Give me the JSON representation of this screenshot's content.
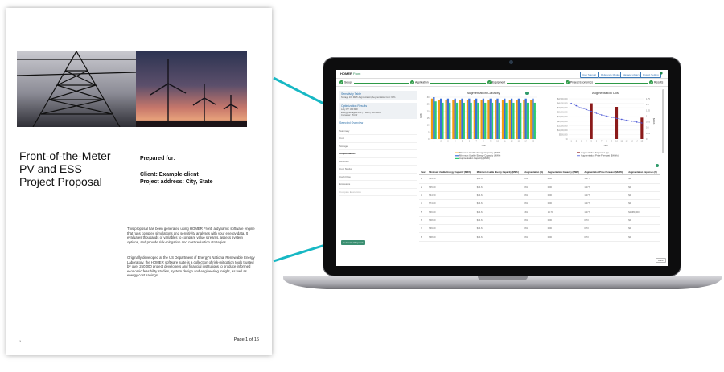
{
  "proposal": {
    "title_lines": [
      "Front-of-the-Meter",
      "PV and ESS",
      "Project Proposal"
    ],
    "prepared_for": "Prepared for:",
    "client": "Client: Example client",
    "project_address": "Project address: City, State",
    "paragraph1": "This proposal has been generated using HOMER Front, a dynamic software engine that runs complex simulations and sensitivity analyses with your energy data. It evaluates thousands of variables to compare value streams, assess system options, and provide risk-mitigation and cost-reduction strategies.",
    "paragraph2": "Originally developed at the US Department of Energy's National Renewable Energy Laboratory, the HOMER software suite is a collection of risk-mitigation tools trusted by over 250,000 project developers and financial institutions to produce informed economic feasibility studies, system design and engineering insight, as well as energy cost savings.",
    "page_label": "Page 1 of 16",
    "corner_mark": "1"
  },
  "app": {
    "logo": "HOMER",
    "logo_suffix": "Front",
    "top_buttons": [
      "User Manual",
      "Reference Modes",
      "Manage Library",
      "Project Setting"
    ],
    "steps": [
      "Setup",
      "Application",
      "Equipment",
      "Project Economics",
      "Results"
    ],
    "sidebar": {
      "sensitivity_title": "Sensitivity Table",
      "sensitivity_text": "Storage 100 MWh Augmentation; Augmentation Cost: 90%",
      "optimization_title": "Optimization Results",
      "optimization_lines": [
        "Lazy PV: 300 MW",
        "Energy Storage 1-100 ( 3 MWh): 100 MWh",
        "Converter: 95 kW"
      ],
      "selected_title": "Selected Overview",
      "items": [
        "Summary",
        "Cost",
        "Storage",
        "Augmentation",
        "Revenue",
        "Cost Stacks",
        "Cash Flow",
        "Emissions",
        "Compare Economics"
      ],
      "active_index": 3,
      "create_button": "Create Proposal"
    },
    "results_table": {
      "headers": [
        "Year",
        "Minimum Usable Energy Capacity (MWh)",
        "Minimum Usable Energy Capacity (MWh)",
        "Augmentation (%)",
        "Augmentation Capacity (MWh)",
        "Augmentation Price Forecast ($/kWh)",
        "Augmentation Expenses ($)"
      ],
      "rows": [
        [
          "1",
          "$44.90",
          "$44.61",
          "0%",
          "0.00",
          "1.27 $",
          "$0"
        ],
        [
          "2",
          "$45.60",
          "$44.61",
          "0%",
          "0.00",
          "1.27 $",
          "$0"
        ],
        [
          "3",
          "$44.90",
          "$44.61",
          "0%",
          "0.00",
          "1.27 $",
          "$0"
        ],
        [
          "4",
          "$74.00",
          "$44.61",
          "0%",
          "0.00",
          "1.27 $",
          "$0"
        ],
        [
          "5",
          "$46.00",
          "$44.61",
          "4%",
          "14.70",
          "1.27 $",
          "$1,380,000"
        ],
        [
          "6",
          "$48.00",
          "$44.61",
          "0%",
          "0.00",
          "0.73",
          "$0"
        ],
        [
          "7",
          "$39.00",
          "$44.61",
          "0%",
          "0.00",
          "0.73",
          "$0"
        ],
        [
          "8",
          "$38.00",
          "$44.61",
          "0%",
          "0.00",
          "0.73",
          "$0"
        ]
      ],
      "back_label": "Back"
    }
  },
  "chart_data": [
    {
      "type": "bar",
      "title": "Augmentation Capacity",
      "ylabel": "MWh",
      "xlabel": "Year",
      "categories": [
        "1",
        "2",
        "3",
        "4",
        "5",
        "6",
        "7",
        "8",
        "9",
        "10",
        "11",
        "12",
        "13",
        "14",
        "15"
      ],
      "series": [
        {
          "name": "Minimum Usable Energy Capacity (MWh)",
          "color": "#f39c12",
          "values": [
            29,
            28,
            28,
            28,
            28,
            28,
            28,
            28,
            28,
            28,
            28,
            28,
            28,
            28,
            28
          ]
        },
        {
          "name": "Minimum Usable Energy Capacity (MWh)",
          "color": "#3b6fd8",
          "values": [
            30,
            29,
            29,
            29,
            29,
            29,
            29,
            29,
            29,
            29,
            29,
            29,
            29,
            29,
            29
          ]
        },
        {
          "name": "Augmentation Capacity (MWh)",
          "color": "#2ecc71",
          "values": [
            27,
            26,
            26,
            26,
            26,
            26,
            26,
            26,
            26,
            26,
            26,
            26,
            26,
            26,
            26
          ]
        }
      ],
      "ylim": [
        0,
        30
      ],
      "y_ticks": [
        "0",
        "5",
        "10",
        "15",
        "20",
        "25",
        "30"
      ],
      "legend_position": "bottom"
    },
    {
      "type": "bar+line",
      "title": "Augmentation Cost",
      "xlabel": "Year",
      "ylabel_left": "",
      "ylabel_right": "$/kWh",
      "categories": [
        "1",
        "2",
        "3",
        "4",
        "5",
        "6",
        "7",
        "8",
        "9",
        "10",
        "11",
        "12",
        "13",
        "14",
        "15"
      ],
      "bars": {
        "name": "Augmentation Expenses ($)",
        "color": "#8b1a1a",
        "values": [
          0,
          0,
          0,
          0,
          4000000,
          0,
          0,
          0,
          0,
          3600000,
          0,
          0,
          0,
          0,
          2400000
        ]
      },
      "line": {
        "name": "Augmentation Price Forecast ($/kWh)",
        "color": "#4b57d6",
        "values": [
          1.55,
          1.45,
          1.35,
          1.28,
          1.2,
          1.12,
          1.05,
          1.0,
          0.95,
          0.9,
          0.86,
          0.82,
          0.78,
          0.74,
          0.7
        ]
      },
      "y_left_ticks": [
        "$0",
        "$500,000",
        "$1,000,000",
        "$1,500,000",
        "$2,000,000",
        "$2,500,000",
        "$3,000,000",
        "$3,500,000",
        "$4,000,000",
        "$4,500,000"
      ],
      "y_right_ticks": [
        "0",
        "0.25",
        "0.5",
        "0.75",
        "1",
        "1.25",
        "1.5",
        "1.75"
      ],
      "ylim_left": [
        0,
        4500000
      ],
      "ylim_right": [
        0,
        1.75
      ],
      "legend_position": "bottom"
    }
  ]
}
